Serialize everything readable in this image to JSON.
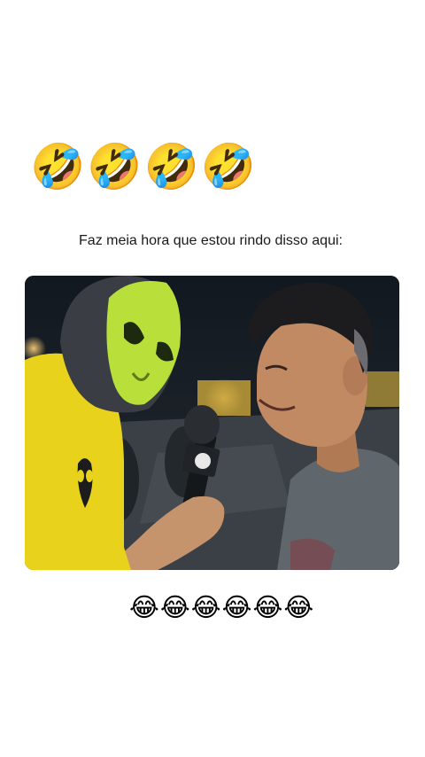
{
  "post": {
    "top_emojis": "🤣🤣🤣🤣",
    "caption": "Faz meia hora que estou rindo disso aqui:",
    "bottom_emojis": "😂😂😂😂😂😂"
  },
  "colors": {
    "background": "#ffffff",
    "shirt": "#e8d21c",
    "mask": "#b9e03a"
  }
}
